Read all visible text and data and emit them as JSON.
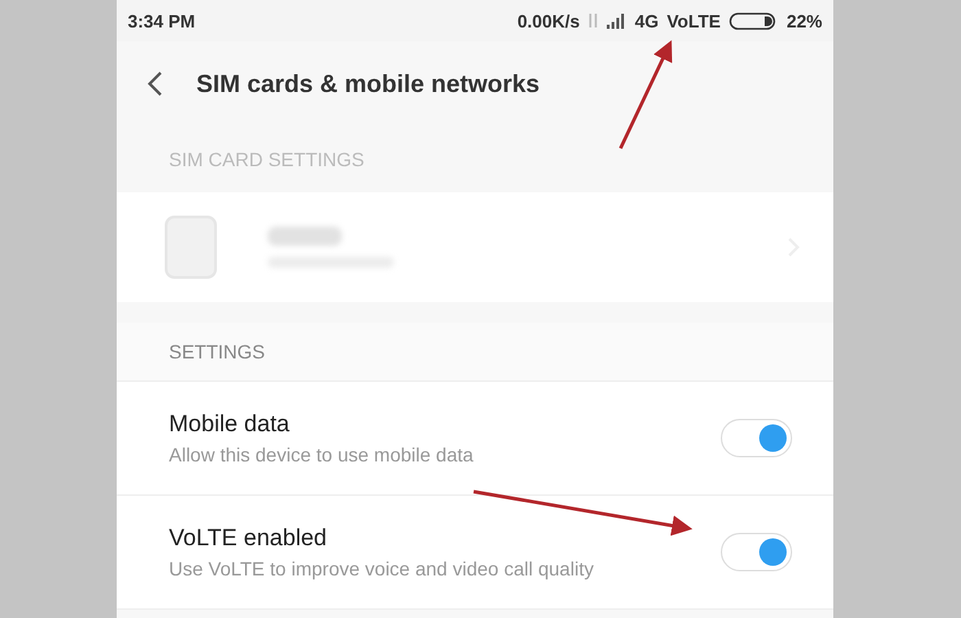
{
  "status_bar": {
    "time": "3:34 PM",
    "speed": "0.00K/s",
    "network": "4G",
    "volte": "VoLTE",
    "battery": "22%"
  },
  "header": {
    "title": "SIM cards & mobile networks"
  },
  "sim_section": {
    "heading": "SIM CARD SETTINGS"
  },
  "settings_section": {
    "heading": "SETTINGS",
    "items": [
      {
        "title": "Mobile data",
        "subtitle": "Allow this device to use mobile data",
        "on": true
      },
      {
        "title": "VoLTE enabled",
        "subtitle": "Use VoLTE to improve voice and video call quality",
        "on": true
      }
    ]
  }
}
